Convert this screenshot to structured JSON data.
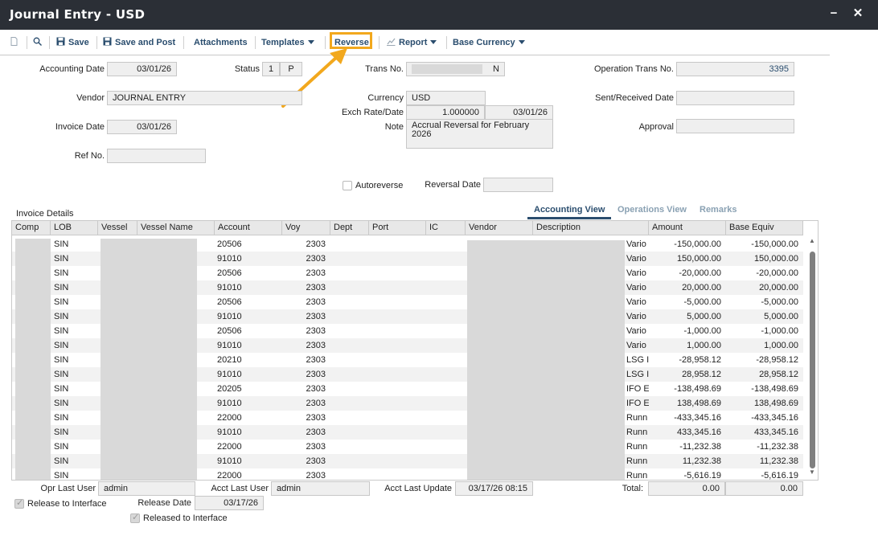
{
  "window": {
    "title": "Journal Entry - USD",
    "minimize": "−",
    "close": "✕"
  },
  "toolbar": {
    "save": "Save",
    "save_and_post": "Save and Post",
    "attachments": "Attachments",
    "templates": "Templates",
    "reverse": "Reverse",
    "report": "Report",
    "base_currency": "Base Currency"
  },
  "header": {
    "accounting_date_label": "Accounting Date",
    "accounting_date": "03/01/26",
    "status_label": "Status",
    "status_code": "1",
    "status_flag": "P",
    "trans_no_label": "Trans No.",
    "trans_no_suffix": "N",
    "operation_trans_no_label": "Operation Trans No.",
    "operation_trans_no": "3395",
    "vendor_label": "Vendor",
    "vendor": "JOURNAL ENTRY",
    "currency_label": "Currency",
    "currency": "USD",
    "sent_received_label": "Sent/Received Date",
    "sent_received": "",
    "exch_label": "Exch Rate/Date",
    "exch_rate": "1.000000",
    "exch_date": "03/01/26",
    "invoice_date_label": "Invoice Date",
    "invoice_date": "03/01/26",
    "note_label": "Note",
    "note": "Accrual Reversal for February 2026",
    "approval_label": "Approval",
    "approval": "",
    "ref_no_label": "Ref No.",
    "ref_no": "",
    "autoreverse_label": "Autoreverse",
    "reversal_date_label": "Reversal Date",
    "reversal_date": ""
  },
  "details": {
    "section_label": "Invoice Details",
    "tabs": [
      "Accounting View",
      "Operations View",
      "Remarks"
    ],
    "columns": [
      "Comp",
      "LOB",
      "Vessel",
      "Vessel Name",
      "Account",
      "Voy",
      "Dept",
      "Port",
      "IC",
      "Vendor",
      "Description",
      "Amount",
      "Base Equiv"
    ],
    "rows": [
      {
        "lob": "SIN",
        "account": "20506",
        "voy": "2303",
        "desc": "Vario",
        "amount": "-150,000.00",
        "base": "-150,000.00"
      },
      {
        "lob": "SIN",
        "account": "91010",
        "voy": "2303",
        "desc": "Vario",
        "amount": "150,000.00",
        "base": "150,000.00"
      },
      {
        "lob": "SIN",
        "account": "20506",
        "voy": "2303",
        "desc": "Vario",
        "amount": "-20,000.00",
        "base": "-20,000.00"
      },
      {
        "lob": "SIN",
        "account": "91010",
        "voy": "2303",
        "desc": "Vario",
        "amount": "20,000.00",
        "base": "20,000.00"
      },
      {
        "lob": "SIN",
        "account": "20506",
        "voy": "2303",
        "desc": "Vario",
        "amount": "-5,000.00",
        "base": "-5,000.00"
      },
      {
        "lob": "SIN",
        "account": "91010",
        "voy": "2303",
        "desc": "Vario",
        "amount": "5,000.00",
        "base": "5,000.00"
      },
      {
        "lob": "SIN",
        "account": "20506",
        "voy": "2303",
        "desc": "Vario",
        "amount": "-1,000.00",
        "base": "-1,000.00"
      },
      {
        "lob": "SIN",
        "account": "91010",
        "voy": "2303",
        "desc": "Vario",
        "amount": "1,000.00",
        "base": "1,000.00"
      },
      {
        "lob": "SIN",
        "account": "20210",
        "voy": "2303",
        "desc": "LSG I",
        "amount": "-28,958.12",
        "base": "-28,958.12"
      },
      {
        "lob": "SIN",
        "account": "91010",
        "voy": "2303",
        "desc": "LSG I",
        "amount": "28,958.12",
        "base": "28,958.12"
      },
      {
        "lob": "SIN",
        "account": "20205",
        "voy": "2303",
        "desc": "IFO E",
        "amount": "-138,498.69",
        "base": "-138,498.69"
      },
      {
        "lob": "SIN",
        "account": "91010",
        "voy": "2303",
        "desc": "IFO E",
        "amount": "138,498.69",
        "base": "138,498.69"
      },
      {
        "lob": "SIN",
        "account": "22000",
        "voy": "2303",
        "desc": "Runn",
        "amount": "-433,345.16",
        "base": "-433,345.16"
      },
      {
        "lob": "SIN",
        "account": "91010",
        "voy": "2303",
        "desc": "Runn",
        "amount": "433,345.16",
        "base": "433,345.16"
      },
      {
        "lob": "SIN",
        "account": "22000",
        "voy": "2303",
        "desc": "Runn",
        "amount": "-11,232.38",
        "base": "-11,232.38"
      },
      {
        "lob": "SIN",
        "account": "91010",
        "voy": "2303",
        "desc": "Runn",
        "amount": "11,232.38",
        "base": "11,232.38"
      },
      {
        "lob": "SIN",
        "account": "22000",
        "voy": "2303",
        "desc": "Runn",
        "amount": "-5,616.19",
        "base": "-5,616.19"
      }
    ]
  },
  "footer": {
    "opr_last_user_label": "Opr Last User",
    "opr_last_user": "admin",
    "acct_last_user_label": "Acct Last User",
    "acct_last_user": "admin",
    "acct_last_update_label": "Acct Last Update",
    "acct_last_update": "03/17/26 08:15",
    "total_label": "Total:",
    "total_amount": "0.00",
    "total_base": "0.00",
    "release_to_interface_label": "Release to Interface",
    "release_date_label": "Release Date",
    "release_date": "03/17/26",
    "released_to_interface_label": "Released to Interface"
  },
  "colors": {
    "titlebar": "#2b2f36",
    "accent": "#2a4d6e",
    "highlight": "#f2a81d"
  }
}
